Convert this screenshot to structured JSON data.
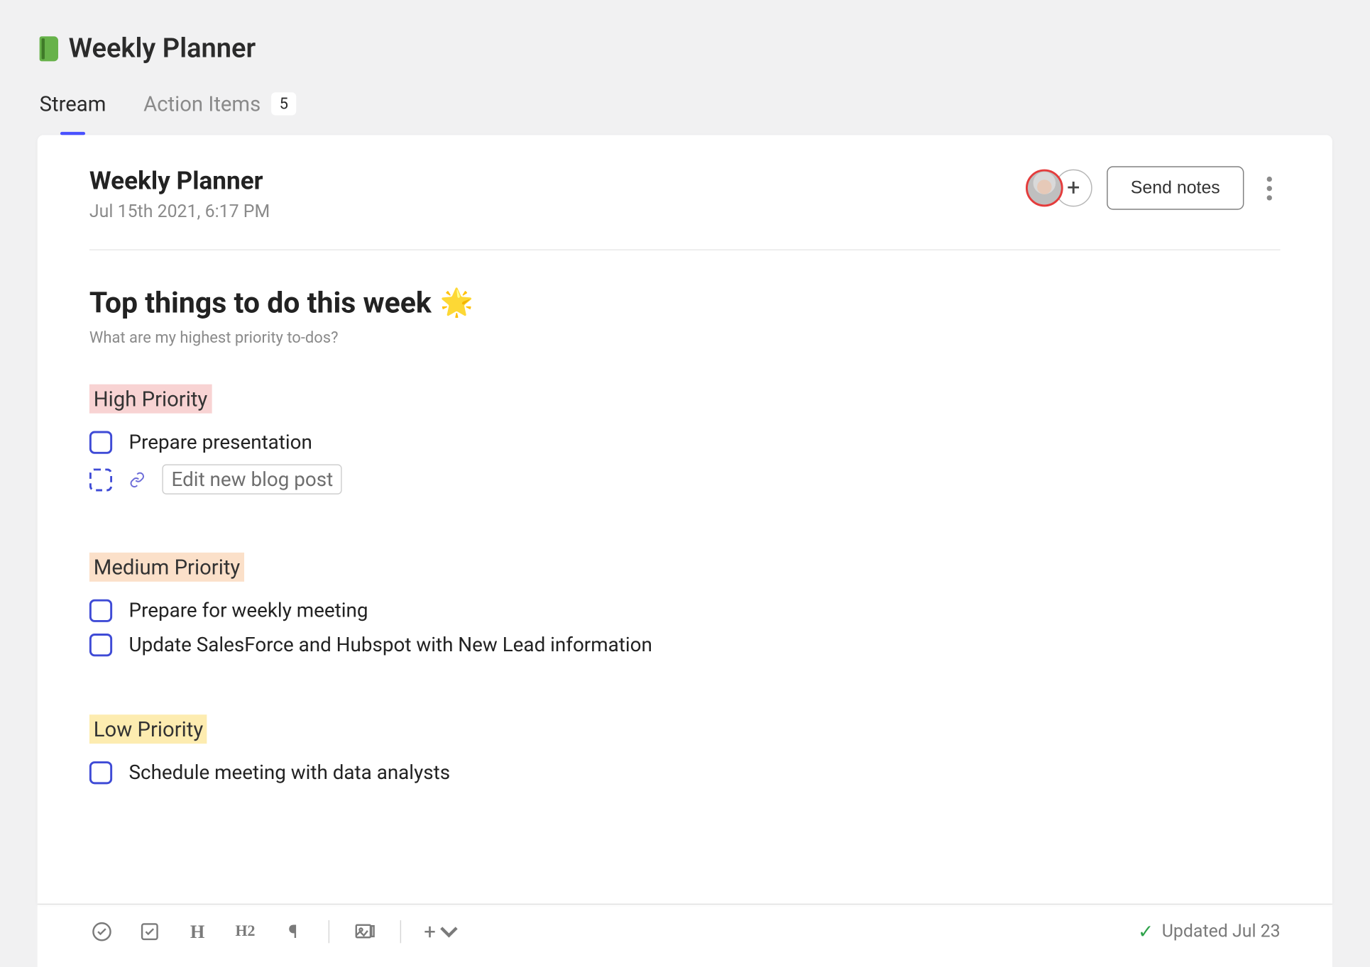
{
  "page": {
    "title": "Weekly Planner"
  },
  "tabs": {
    "stream": "Stream",
    "action_items": "Action Items",
    "action_items_count": "5"
  },
  "card": {
    "title": "Weekly Planner",
    "datetime": "Jul 15th 2021, 6:17 PM",
    "send_label": "Send notes"
  },
  "content": {
    "heading": "Top things to do this week",
    "heading_emoji": "🌟",
    "subheading": "What are my highest priority to-dos?",
    "sections": {
      "high": {
        "label": "High Priority",
        "items": [
          "Prepare presentation",
          "Edit new blog post"
        ]
      },
      "medium": {
        "label": "Medium Priority",
        "items": [
          "Prepare for weekly meeting",
          "Update SalesForce and Hubspot with New Lead information"
        ]
      },
      "low": {
        "label": "Low Priority",
        "items": [
          "Schedule meeting with data analysts"
        ]
      }
    }
  },
  "footer": {
    "updated_label": "Updated Jul 23"
  }
}
